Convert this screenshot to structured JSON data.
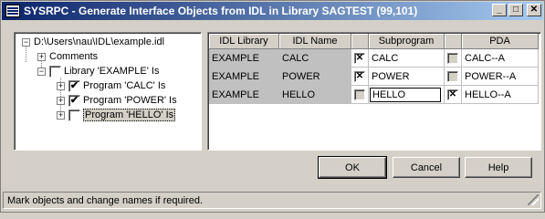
{
  "window": {
    "title": "SYSRPC - Generate Interface Objects from IDL in Library SAGTEST (99,101)",
    "controls": {
      "minimize": "_",
      "maximize": "□",
      "close": "✕"
    }
  },
  "tree": {
    "root": {
      "label": "D:\\Users\\nau\\IDL\\example.idl",
      "expander": "−"
    },
    "comments": {
      "label": "Comments",
      "expander": "+"
    },
    "library": {
      "label": "Library 'EXAMPLE' Is",
      "expander": "−",
      "checked": false
    },
    "programs": [
      {
        "label": "Program 'CALC' Is",
        "expander": "+",
        "checked": true,
        "check_glyph": "✔"
      },
      {
        "label": "Program 'POWER' Is",
        "expander": "+",
        "checked": true,
        "check_glyph": "✔"
      },
      {
        "label": "Program 'HELLO' Is",
        "expander": "+",
        "checked": false,
        "check_glyph": ""
      }
    ]
  },
  "grid": {
    "headers": {
      "idl_library": "IDL Library",
      "idl_name": "IDL Name",
      "check1": "",
      "subprogram": "Subprogram",
      "check2": "",
      "pda": "PDA"
    },
    "rows": [
      {
        "library": "EXAMPLE",
        "name": "CALC",
        "sub_check": "✕",
        "subprogram": "CALC",
        "pda_check": "",
        "pda": "CALC--A"
      },
      {
        "library": "EXAMPLE",
        "name": "POWER",
        "sub_check": "✕",
        "subprogram": "POWER",
        "pda_check": "",
        "pda": "POWER--A"
      },
      {
        "library": "EXAMPLE",
        "name": "HELLO",
        "sub_check": "",
        "subprogram": "HELLO",
        "pda_check": "✕",
        "pda": "HELLO--A"
      }
    ]
  },
  "buttons": {
    "ok": "OK",
    "cancel": "Cancel",
    "help": "Help"
  },
  "status": "Mark objects and change names if required."
}
